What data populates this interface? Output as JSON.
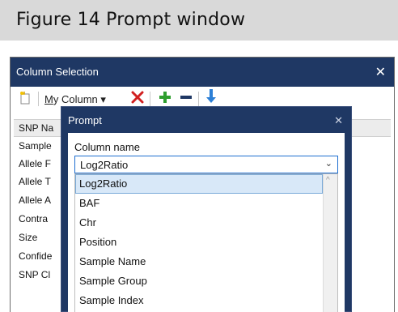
{
  "figure": {
    "title": "Figure 14   Prompt window"
  },
  "window": {
    "title": "Column Selection",
    "close_glyph": "✕",
    "toolbar": {
      "my_column_label": "My Column",
      "my_column_prefix": "M",
      "my_column_rest": "y Column",
      "dropdown_glyph": "▾",
      "icons": [
        "new-column-icon",
        "delete-icon",
        "add-icon",
        "remove-icon",
        "move-down-icon"
      ],
      "colors": {
        "delete": "#d12020",
        "add": "#2e9e2e",
        "remove": "#1f3864",
        "move": "#2c7fd6"
      }
    },
    "list": {
      "header": "SNP Na",
      "rows": [
        "Sample",
        "Allele F",
        "Allele T",
        "Allele A",
        "Contra",
        "Size",
        "Confide",
        "SNP Cl"
      ]
    }
  },
  "prompt": {
    "title": "Prompt",
    "close_glyph": "✕",
    "field_label": "Column name",
    "selected_value": "Log2Ratio",
    "chevron": "⌄",
    "options": [
      "Log2Ratio",
      "BAF",
      "Chr",
      "Position",
      "Sample Name",
      "Sample Group",
      "Sample Index"
    ],
    "selected_option": "Log2Ratio",
    "scroll_up_glyph": "^"
  },
  "colors": {
    "title_bar": "#1f3864",
    "caption_bar": "#d9d9d9",
    "selected_item": "#d8e8f8"
  }
}
